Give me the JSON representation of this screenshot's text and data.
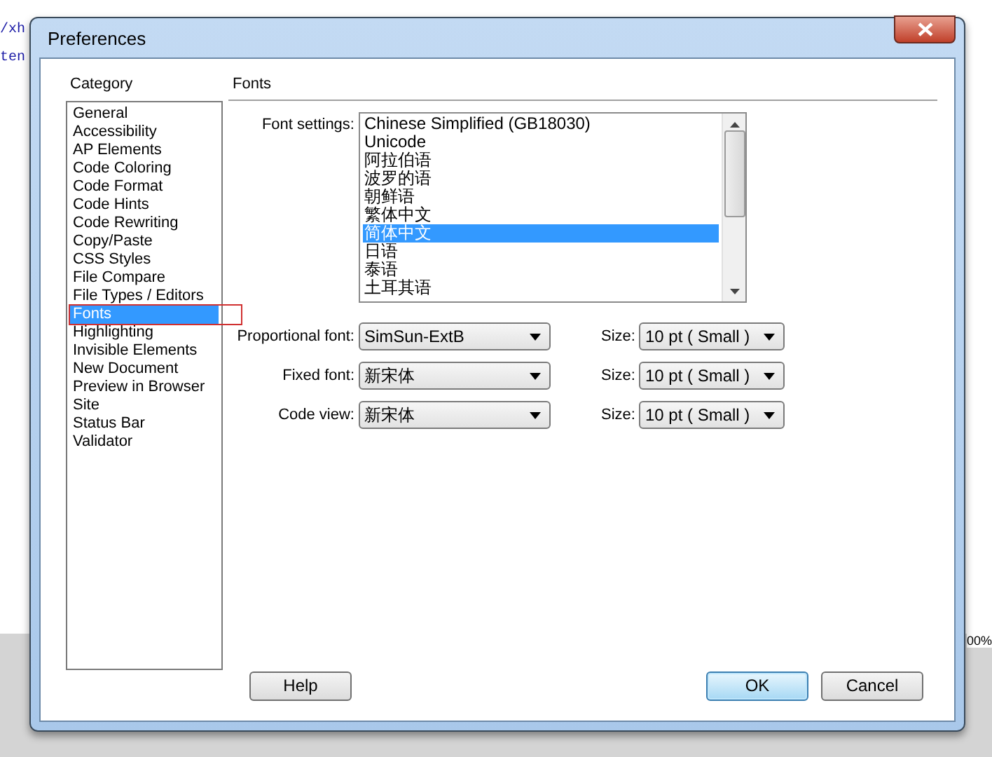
{
  "editor_background": {
    "lines": [
      "/xh",
      "ten"
    ],
    "zoom_text": "00%"
  },
  "window": {
    "title": "Preferences"
  },
  "category": {
    "label": "Category",
    "items": [
      {
        "label": "General",
        "selected": false
      },
      {
        "label": "Accessibility",
        "selected": false
      },
      {
        "label": "AP Elements",
        "selected": false
      },
      {
        "label": "Code Coloring",
        "selected": false
      },
      {
        "label": "Code Format",
        "selected": false
      },
      {
        "label": "Code Hints",
        "selected": false
      },
      {
        "label": "Code Rewriting",
        "selected": false
      },
      {
        "label": "Copy/Paste",
        "selected": false
      },
      {
        "label": "CSS Styles",
        "selected": false
      },
      {
        "label": "File Compare",
        "selected": false
      },
      {
        "label": "File Types / Editors",
        "selected": false
      },
      {
        "label": "Fonts",
        "selected": true
      },
      {
        "label": "Highlighting",
        "selected": false
      },
      {
        "label": "Invisible Elements",
        "selected": false
      },
      {
        "label": "New Document",
        "selected": false
      },
      {
        "label": "Preview in Browser",
        "selected": false
      },
      {
        "label": "Site",
        "selected": false
      },
      {
        "label": "Status Bar",
        "selected": false
      },
      {
        "label": "Validator",
        "selected": false
      }
    ]
  },
  "panel": {
    "title": "Fonts",
    "font_settings": {
      "label": "Font settings:",
      "items": [
        {
          "label": "Chinese Simplified (GB18030)",
          "selected": false
        },
        {
          "label": "Unicode",
          "selected": false
        },
        {
          "label": "阿拉伯语",
          "selected": false
        },
        {
          "label": "波罗的语",
          "selected": false
        },
        {
          "label": "朝鲜语",
          "selected": false
        },
        {
          "label": "繁体中文",
          "selected": false
        },
        {
          "label": "简体中文",
          "selected": true
        },
        {
          "label": "日语",
          "selected": false
        },
        {
          "label": "泰语",
          "selected": false
        },
        {
          "label": "土耳其语",
          "selected": false
        }
      ]
    },
    "font_rows": [
      {
        "label": "Proportional font:",
        "value": "SimSun-ExtB",
        "size_label": "Size:",
        "size": "10 pt ( Small )"
      },
      {
        "label": "Fixed font:",
        "value": "新宋体",
        "size_label": "Size:",
        "size": "10 pt ( Small )"
      },
      {
        "label": "Code view:",
        "value": "新宋体",
        "size_label": "Size:",
        "size": "10 pt ( Small )"
      }
    ]
  },
  "buttons": [
    {
      "label": "Help",
      "kind": "help"
    },
    {
      "label": "OK",
      "kind": "default"
    },
    {
      "label": "Cancel",
      "kind": "normal"
    }
  ]
}
